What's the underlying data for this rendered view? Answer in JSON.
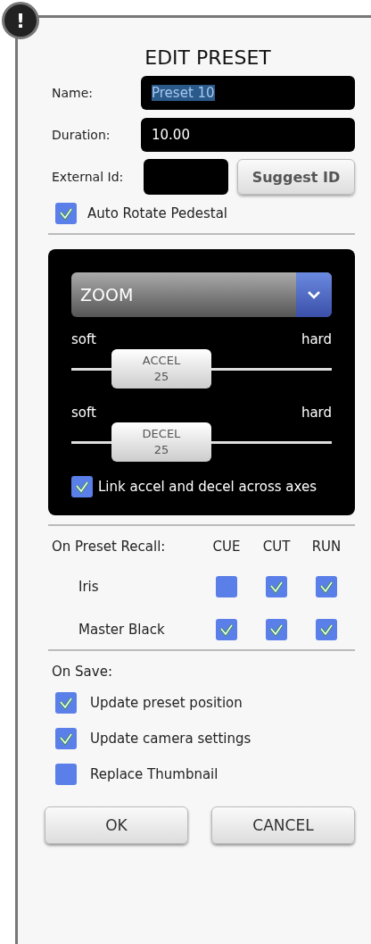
{
  "alert_badge": "!",
  "title": "EDIT PRESET",
  "fields": [
    {
      "label": "Name:",
      "value": "Preset 10",
      "highlighted": true,
      "kind": "wide"
    },
    {
      "label": "Duration:",
      "value": "10.00",
      "kind": "wide"
    },
    {
      "label": "External Id:",
      "kind": "short",
      "button": "Suggest ID"
    }
  ],
  "auto_rotate": {
    "label": "Auto Rotate Pedestal",
    "checked": true
  },
  "axis_panel": {
    "dropdown": {
      "value": "ZOOM"
    },
    "sliders": [
      {
        "min_label": "soft",
        "max_label": "hard",
        "name": "ACCEL",
        "reading": "25",
        "level": 0.25
      },
      {
        "min_label": "soft",
        "max_label": "hard",
        "name": "DECEL",
        "reading": "25",
        "level": 0.25
      }
    ],
    "link": {
      "label": "Link accel and decel across axes",
      "checked": true
    }
  },
  "recall": {
    "heading": "On Preset Recall:",
    "columns": [
      "CUE",
      "CUT",
      "RUN"
    ],
    "rows": [
      {
        "label": "Iris",
        "checks": [
          false,
          true,
          true
        ]
      },
      {
        "label": "Master Black",
        "checks": [
          true,
          true,
          true
        ]
      }
    ]
  },
  "on_save": {
    "heading": "On Save:",
    "items": [
      {
        "label": "Update preset position",
        "checked": true
      },
      {
        "label": "Update camera settings",
        "checked": true
      },
      {
        "label": "Replace Thumbnail",
        "checked": false
      }
    ]
  },
  "buttons": [
    "OK",
    "CANCEL"
  ]
}
